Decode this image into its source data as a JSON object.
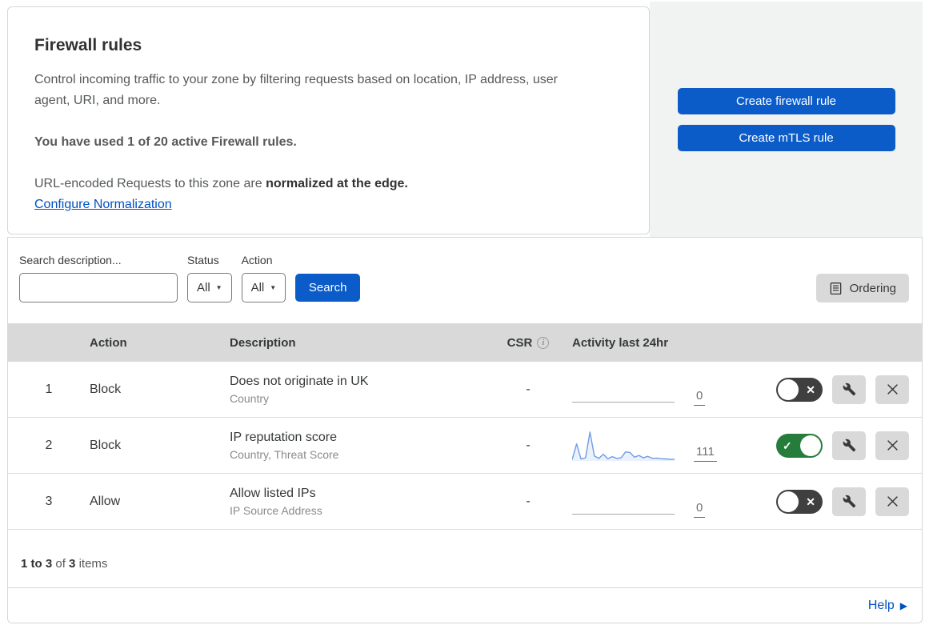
{
  "page": {
    "title": "Firewall rules",
    "description": "Control incoming traffic to your zone by filtering requests based on location, IP address, user agent, URI, and more.",
    "usage_notice": "You have used 1 of 20 active Firewall rules.",
    "normalization_text": "URL-encoded Requests to this zone are ",
    "normalization_bold": "normalized at the edge.",
    "normalization_link": "Configure Normalization"
  },
  "actions_panel": {
    "create_firewall_rule_label": "Create firewall rule",
    "create_mtls_rule_label": "Create mTLS rule"
  },
  "filters": {
    "search_label": "Search description...",
    "search_value": "",
    "status_label": "Status",
    "status_value": "All",
    "action_label": "Action",
    "action_value": "All",
    "search_button_label": "Search",
    "ordering_button_label": "Ordering"
  },
  "table": {
    "headers": {
      "action": "Action",
      "description": "Description",
      "csr": "CSR",
      "activity": "Activity last 24hr"
    },
    "rows": [
      {
        "priority": "1",
        "action": "Block",
        "description": "Does not originate in UK",
        "criteria": "Country",
        "csr": "-",
        "activity_count": "0",
        "enabled": false
      },
      {
        "priority": "2",
        "action": "Block",
        "description": "IP reputation score",
        "criteria": "Country, Threat Score",
        "csr": "-",
        "activity_count": "111",
        "enabled": true
      },
      {
        "priority": "3",
        "action": "Allow",
        "description": "Allow listed IPs",
        "criteria": "IP Source Address",
        "csr": "-",
        "activity_count": "0",
        "enabled": false
      }
    ]
  },
  "footer": {
    "range": "1 to 3",
    "of": "of",
    "total": "3",
    "items": "items"
  },
  "help": {
    "label": "Help"
  },
  "chart_data": {
    "type": "area",
    "title": "Activity last 24hr sparkline (rule 2: IP reputation score)",
    "note": "Sparkline has no axes; values are relative heights (0-100) estimated from pixels over ~24 hourly points. Labeled total is 111.",
    "values": [
      2,
      55,
      4,
      8,
      95,
      14,
      6,
      20,
      5,
      12,
      6,
      8,
      28,
      26,
      10,
      16,
      8,
      13,
      6,
      7,
      5,
      4,
      3,
      3
    ],
    "total_label": "111",
    "line_color": "#6f9ce6",
    "fill_color": "#eaf1fb",
    "flat_rows": {
      "rows": [
        "1",
        "3"
      ],
      "value": 0
    }
  },
  "colors": {
    "primary_button": "#0b5cc9",
    "link": "#0051c3",
    "toggle_on": "#267d3b",
    "toggle_off": "#3f3f3f",
    "table_header_bg": "#d9d9d9",
    "actions_panel_bg": "#f1f2f2",
    "icon_button_bg": "#d9d9d9",
    "sparkline_line": "#6f9ce6"
  },
  "icons": {
    "search": "magnifier",
    "ordering": "list-document",
    "csr_info": "info-circle",
    "edit": "wrench",
    "delete": "close-x",
    "toggle_off_glyph": "x-mark",
    "toggle_on_glyph": "check-mark",
    "help_arrow": "right-triangle",
    "dropdown_caret": "down-triangle"
  }
}
